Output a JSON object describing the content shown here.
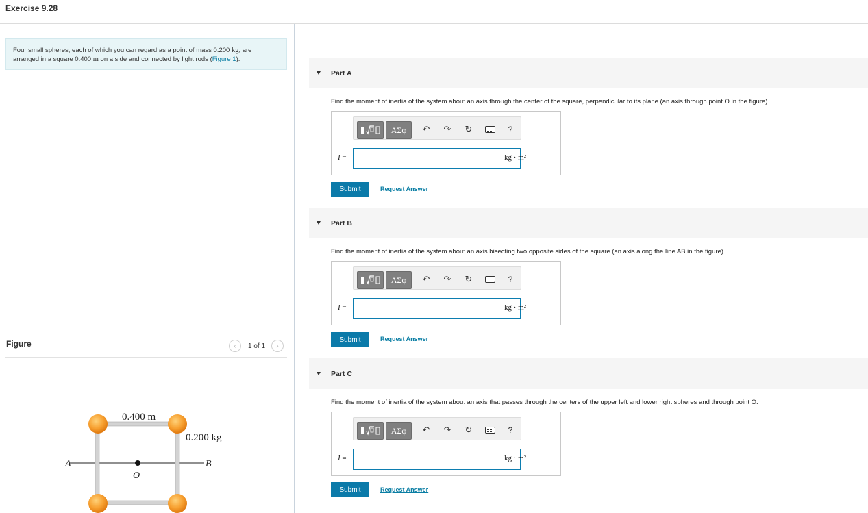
{
  "exercise": {
    "title": "Exercise 9.28"
  },
  "problem": {
    "text_1": "Four small spheres, each of which you can regard as a point of mass 0.200 ",
    "unit_kg": "kg",
    "text_2": ", are arranged in a square 0.400 ",
    "unit_m": "m",
    "text_3": " on a side and connected by light rods (",
    "figure_link": "Figure 1",
    "text_4": ")."
  },
  "figure": {
    "label": "Figure",
    "pager_text": "1 of 1",
    "prev_icon": "chevron-left-icon",
    "next_icon": "chevron-right-icon",
    "side_label": "0.400 m",
    "mass_label": "0.200 kg",
    "point_a": "A",
    "point_b": "B",
    "point_o": "O",
    "sphere_color": "#f7a030",
    "rod_color": "#c8c8c8"
  },
  "toolbar": {
    "templates_icon": "templates-icon",
    "greek_label": "ΑΣφ",
    "undo_icon": "undo-icon",
    "redo_icon": "redo-icon",
    "reset_icon": "reset-icon",
    "keyboard_icon": "keyboard-icon",
    "help_label": "?"
  },
  "parts": [
    {
      "title": "Part A",
      "question": "Find the moment of inertia of the system about an axis through the center of the square, perpendicular to its plane (an axis through point O in the figure).",
      "variable": "I",
      "equals": " =",
      "unit": "kg · m²",
      "answer_value": "",
      "submit_label": "Submit",
      "request_label": "Request Answer"
    },
    {
      "title": "Part B",
      "question": "Find the moment of inertia of the system about an axis bisecting two opposite sides of the square (an axis along the line AB in the figure).",
      "variable": "I",
      "equals": " =",
      "unit": "kg · m²",
      "answer_value": "",
      "submit_label": "Submit",
      "request_label": "Request Answer"
    },
    {
      "title": "Part C",
      "question": "Find the moment of inertia of the system about an axis that passes through the centers of the upper left and lower right spheres and through point O.",
      "variable": "I",
      "equals": " =",
      "unit": "kg · m²",
      "answer_value": "",
      "submit_label": "Submit",
      "request_label": "Request Answer"
    }
  ],
  "colors": {
    "accent": "#0b7aa9",
    "link": "#0a7ea4",
    "problem_bg": "#e8f5f7"
  }
}
